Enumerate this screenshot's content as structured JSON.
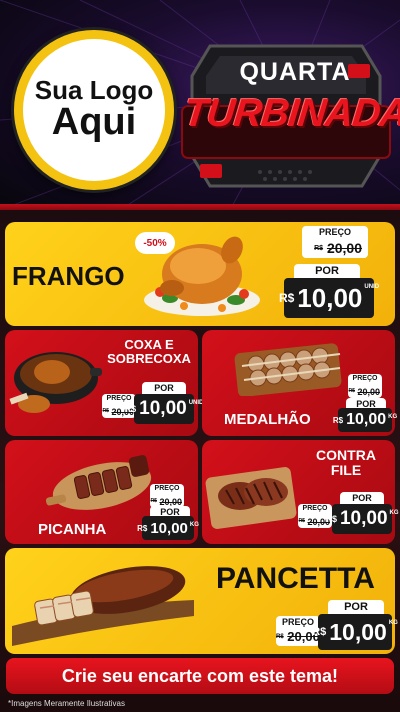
{
  "header": {
    "logo_line1": "Sua Logo",
    "logo_line2": "Aqui",
    "title_line1": "QUARTA",
    "title_line2": "TURBINADA"
  },
  "products": {
    "frango": {
      "name": "FRANGO",
      "discount": "-50%",
      "price_label": "PREÇO",
      "old_currency": "R$",
      "old_price": "20,00",
      "por_label": "POR",
      "new_currency": "R$",
      "new_price": "10,00",
      "unit": "UNID"
    },
    "coxa": {
      "name_line1": "COXA E",
      "name_line2": "SOBRECOXA",
      "por_label": "POR",
      "price_label": "PREÇO",
      "old_currency": "R$",
      "old_price": "20,00",
      "new_currency": "R$",
      "new_price": "10,00",
      "unit": "UNID"
    },
    "medalhao": {
      "name": "MEDALHÃO",
      "price_label": "PREÇO",
      "old_currency": "R$",
      "old_price": "20,00",
      "por_label": "POR",
      "new_currency": "R$",
      "new_price": "10,00",
      "unit": "KG"
    },
    "picanha": {
      "name": "PICANHA",
      "price_label": "PREÇO",
      "old_currency": "R$",
      "old_price": "20,00",
      "por_label": "POR",
      "new_currency": "R$",
      "new_price": "10,00",
      "unit": "KG"
    },
    "contra_file": {
      "name_line1": "CONTRA",
      "name_line2": "FILE",
      "por_label": "POR",
      "price_label": "PREÇO",
      "old_currency": "R$",
      "old_price": "20,00",
      "new_currency": "R$",
      "new_price": "10,00",
      "unit": "KG"
    },
    "pancetta": {
      "name": "PANCETTA",
      "por_label": "POR",
      "price_label": "PREÇO",
      "old_currency": "R$",
      "old_price": "20,00",
      "new_currency": "R$",
      "new_price": "10,00",
      "unit": "KG"
    }
  },
  "banner": "Crie seu encarte com este tema!",
  "disclaimer": "*Imagens Meramente Ilustrativas",
  "colors": {
    "yellow": "#ffd21a",
    "red": "#d3101a",
    "dark": "#1a1a1a",
    "logo_ring": "#f4c312"
  }
}
